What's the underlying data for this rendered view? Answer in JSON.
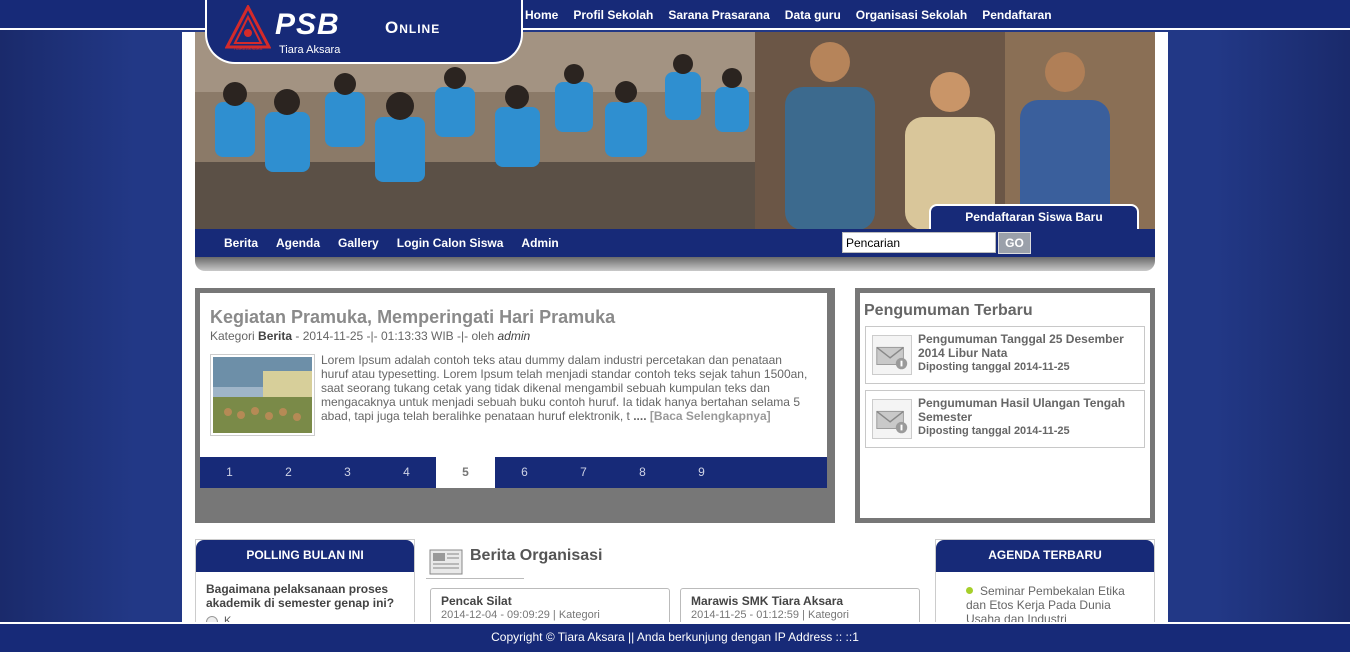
{
  "topnav": {
    "items": [
      "Home",
      "Profil Sekolah",
      "Sarana Prasarana",
      "Data guru",
      "Organisasi Sekolah",
      "Pendaftaran"
    ]
  },
  "logo": {
    "title": "PSB",
    "online": "Online",
    "subtitle": "Tiara Aksara",
    "badge_text": "TIARA AKSARA"
  },
  "banner": {
    "register_tab": "Pendaftaran Siswa Baru"
  },
  "subnav": {
    "items": [
      "Berita",
      "Agenda",
      "Gallery",
      "Login Calon Siswa",
      "Admin"
    ],
    "search_value": "Pencarian",
    "search_button": "GO"
  },
  "news": {
    "title": "Kegiatan Pramuka, Memperingati Hari Pramuka",
    "meta_prefix": "Kategori ",
    "category": "Berita",
    "meta_middle": " - 2014-11-25 -|- 01:13:33 WIB -|- oleh ",
    "author": "admin",
    "body": "Lorem Ipsum adalah contoh teks atau dummy dalam industri percetakan dan penataan huruf atau typesetting. Lorem Ipsum telah menjadi standar contoh teks sejak tahun 1500an, saat seorang tukang cetak yang tidak dikenal mengambil sebuah kumpulan teks dan mengacaknya untuk menjadi sebuah buku contoh huruf. Ia tidak hanya bertahan selama 5 abad, tapi juga telah beralihke penataan huruf elektronik, t",
    "ellipsis": " .... ",
    "read_more": "[Baca Selengkapnya]",
    "pages": [
      "1",
      "2",
      "3",
      "4",
      "5",
      "6",
      "7",
      "8",
      "9"
    ],
    "active_page": "5"
  },
  "announcements": {
    "title": "Pengumuman Terbaru",
    "items": [
      {
        "title": "Pengumuman Tanggal 25 Desember 2014 Libur Nata",
        "date": "Diposting tanggal 2014-11-25"
      },
      {
        "title": "Pengumuman Hasil Ulangan Tengah Semester",
        "date": "Diposting tanggal 2014-11-25"
      }
    ]
  },
  "poll": {
    "heading": "POLLING BULAN INI",
    "question": "Bagaimana pelaksanaan proses akademik di semester genap ini?",
    "first_option": "K"
  },
  "org": {
    "heading": "Berita Organisasi",
    "cards": [
      {
        "title": "Pencak Silat",
        "meta": "2014-12-04 - 09:09:29 | Kategori"
      },
      {
        "title": "Marawis SMK Tiara Aksara",
        "meta": "2014-11-25 - 01:12:59 | Kategori"
      }
    ]
  },
  "agenda": {
    "heading": "AGENDA TERBARU",
    "first_item": "Seminar Pembekalan Etika dan Etos Kerja Pada Dunia Usaha dan Industri"
  },
  "footer": {
    "text": "Copyright © Tiara Aksara || Anda berkunjung dengan IP Address :: ::1"
  },
  "colors": {
    "navy": "#172a78",
    "background_blue": "#223886",
    "gray_frame": "#777777",
    "accent_green": "#a6cf2a"
  }
}
